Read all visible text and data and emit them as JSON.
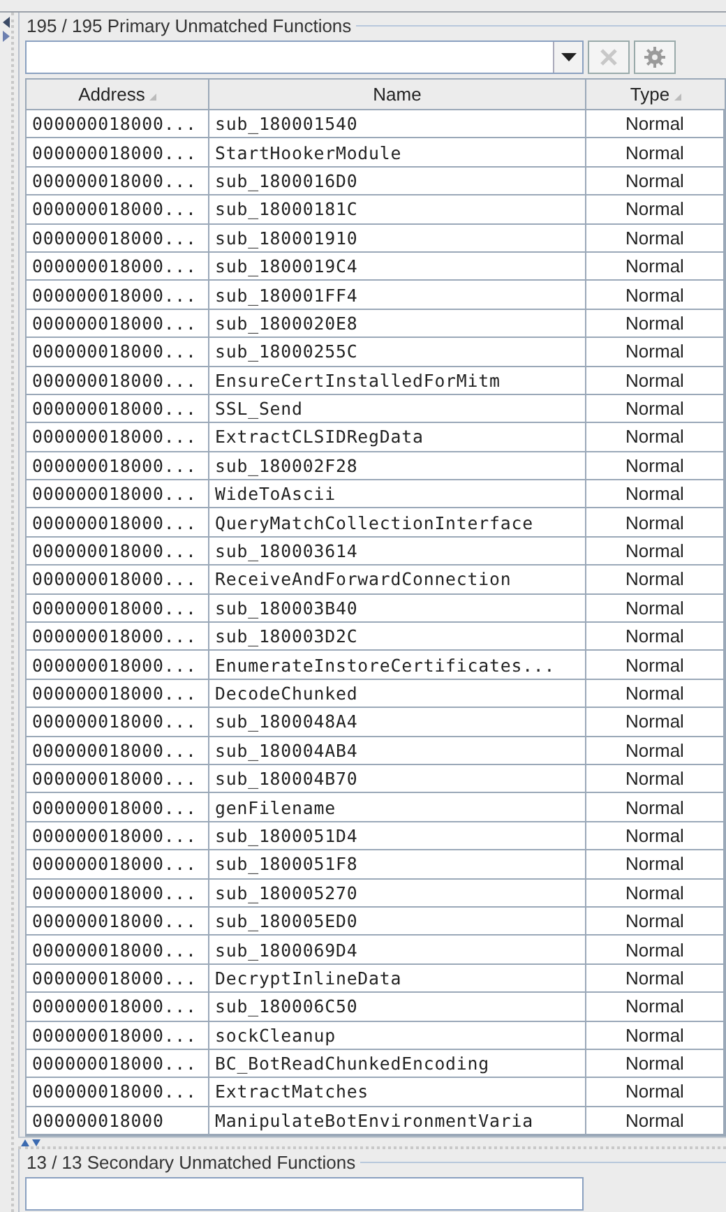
{
  "primary": {
    "title": "195 / 195 Primary Unmatched Functions",
    "columns": [
      {
        "label": "Address",
        "sorted": true
      },
      {
        "label": "Name",
        "sorted": false
      },
      {
        "label": "Type",
        "sorted": true
      }
    ],
    "rows": [
      {
        "address": "000000018000...",
        "name": "sub_180001540",
        "type": "Normal"
      },
      {
        "address": "000000018000...",
        "name": "StartHookerModule",
        "type": "Normal"
      },
      {
        "address": "000000018000...",
        "name": "sub_1800016D0",
        "type": "Normal"
      },
      {
        "address": "000000018000...",
        "name": "sub_18000181C",
        "type": "Normal"
      },
      {
        "address": "000000018000...",
        "name": "sub_180001910",
        "type": "Normal"
      },
      {
        "address": "000000018000...",
        "name": "sub_1800019C4",
        "type": "Normal"
      },
      {
        "address": "000000018000...",
        "name": "sub_180001FF4",
        "type": "Normal"
      },
      {
        "address": "000000018000...",
        "name": "sub_1800020E8",
        "type": "Normal"
      },
      {
        "address": "000000018000...",
        "name": "sub_18000255C",
        "type": "Normal"
      },
      {
        "address": "000000018000...",
        "name": "EnsureCertInstalledForMitm",
        "type": "Normal"
      },
      {
        "address": "000000018000...",
        "name": "SSL_Send",
        "type": "Normal"
      },
      {
        "address": "000000018000...",
        "name": "ExtractCLSIDRegData",
        "type": "Normal"
      },
      {
        "address": "000000018000...",
        "name": "sub_180002F28",
        "type": "Normal"
      },
      {
        "address": "000000018000...",
        "name": "WideToAscii",
        "type": "Normal"
      },
      {
        "address": "000000018000...",
        "name": "QueryMatchCollectionInterface",
        "type": "Normal"
      },
      {
        "address": "000000018000...",
        "name": "sub_180003614",
        "type": "Normal"
      },
      {
        "address": "000000018000...",
        "name": "ReceiveAndForwardConnection",
        "type": "Normal"
      },
      {
        "address": "000000018000...",
        "name": "sub_180003B40",
        "type": "Normal"
      },
      {
        "address": "000000018000...",
        "name": "sub_180003D2C",
        "type": "Normal"
      },
      {
        "address": "000000018000...",
        "name": "EnumerateInstoreCertificates...",
        "type": "Normal"
      },
      {
        "address": "000000018000...",
        "name": "DecodeChunked",
        "type": "Normal"
      },
      {
        "address": "000000018000...",
        "name": "sub_1800048A4",
        "type": "Normal"
      },
      {
        "address": "000000018000...",
        "name": "sub_180004AB4",
        "type": "Normal"
      },
      {
        "address": "000000018000...",
        "name": "sub_180004B70",
        "type": "Normal"
      },
      {
        "address": "000000018000...",
        "name": "genFilename",
        "type": "Normal"
      },
      {
        "address": "000000018000...",
        "name": "sub_1800051D4",
        "type": "Normal"
      },
      {
        "address": "000000018000...",
        "name": "sub_1800051F8",
        "type": "Normal"
      },
      {
        "address": "000000018000...",
        "name": "sub_180005270",
        "type": "Normal"
      },
      {
        "address": "000000018000...",
        "name": "sub_180005ED0",
        "type": "Normal"
      },
      {
        "address": "000000018000...",
        "name": "sub_1800069D4",
        "type": "Normal"
      },
      {
        "address": "000000018000...",
        "name": "DecryptInlineData",
        "type": "Normal"
      },
      {
        "address": "000000018000...",
        "name": "sub_180006C50",
        "type": "Normal"
      },
      {
        "address": "000000018000...",
        "name": "sockCleanup",
        "type": "Normal"
      },
      {
        "address": "000000018000...",
        "name": "BC_BotReadChunkedEncoding",
        "type": "Normal"
      },
      {
        "address": "000000018000...",
        "name": "ExtractMatches",
        "type": "Normal"
      },
      {
        "address": "000000018000",
        "name": "ManipulateBotEnvironmentVaria",
        "type": "Normal"
      }
    ]
  },
  "secondary": {
    "title": "13 / 13 Secondary Unmatched Functions"
  }
}
